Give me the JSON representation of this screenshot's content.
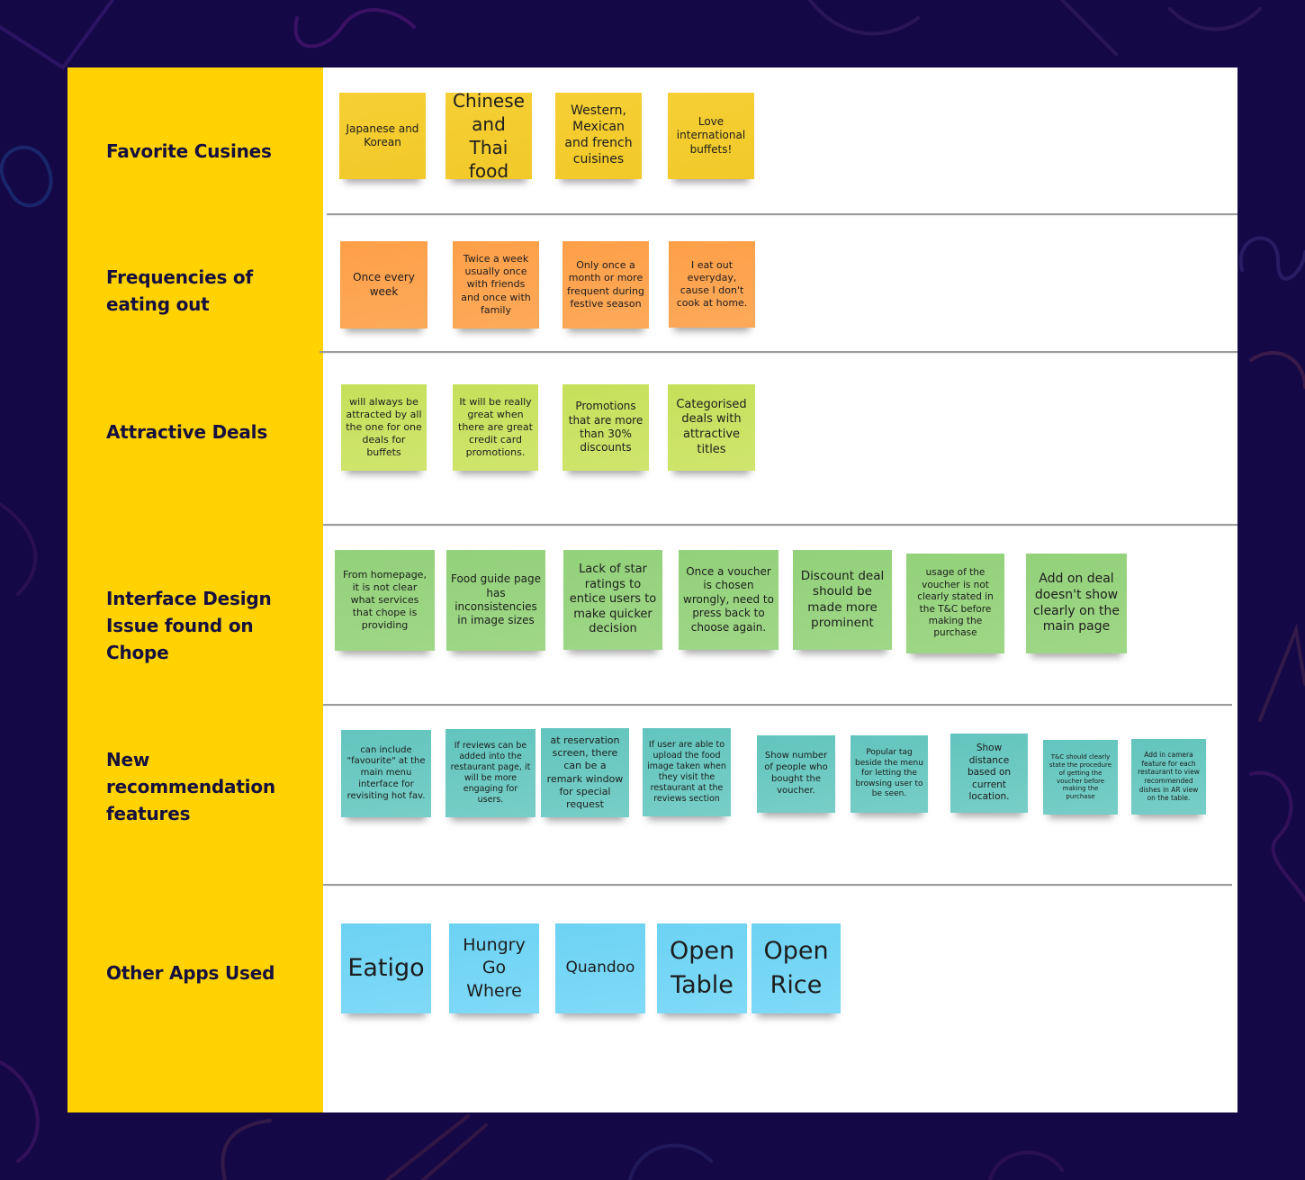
{
  "theme": {
    "background": "#150847",
    "label_column": "#ffd200",
    "label_text": "#15103f",
    "board": "#ffffff",
    "note_colors": {
      "yellow": "#f3cb2d",
      "orange": "#fea250",
      "lime": "#c9e262",
      "green": "#97d37f",
      "teal": "#69c8c0",
      "cyan": "#74d5f5"
    }
  },
  "rows": [
    {
      "label": "Favorite Cusines",
      "color": "yellow",
      "notes": [
        "Japanese and  Korean",
        "Chinese and Thai food",
        "Western, Mexican and french cuisines",
        "Love international buffets!"
      ]
    },
    {
      "label": "Frequencies of eating out",
      "color": "orange",
      "notes": [
        "Once every week",
        "Twice a week usually once with friends and once with family",
        "Only once a month or more frequent during festive season",
        "I eat out everyday, cause I don't cook at home."
      ]
    },
    {
      "label": "Attractive Deals",
      "color": "lime",
      "notes": [
        "will always be attracted by all the one for one deals for buffets",
        "It will be really great when there are great credit card promotions.",
        "Promotions that are more than 30% discounts",
        "Categorised deals with attractive titles"
      ]
    },
    {
      "label": "Interface Design Issue found on Chope",
      "color": "green",
      "notes": [
        "From homepage, it is not clear what services that chope is providing",
        "Food guide page has inconsistencies in image sizes",
        "Lack of star ratings to entice users to make quicker decision",
        "Once a voucher is chosen wrongly, need to press back to choose again.",
        "Discount deal should be made more prominent",
        "usage of the voucher is not clearly stated in the T&C before making the purchase",
        "Add on deal doesn't show clearly on the main page"
      ]
    },
    {
      "label": "New recommendation features",
      "color": "teal",
      "notes": [
        "can include \"favourite\" at the main menu interface for revisiting hot fav.",
        "If reviews can be added into the restaurant page, it will be more engaging for users.",
        "at reservation screen, there can be a remark window for special request",
        "If user are able to upload the food image taken when they visit the restaurant at the reviews section",
        "Show number of people who bought the voucher.",
        "Popular tag beside the menu for letting the browsing user to be seen.",
        "Show distance based on current location.",
        "T&C should clearly state the procedure of getting the voucher before making the purchase",
        "Add in camera feature for each restaurant to view recommended dishes in AR view on the table."
      ]
    },
    {
      "label": "Other Apps Used",
      "color": "cyan",
      "notes": [
        "Eatigo",
        "Hungry Go Where",
        "Quandoo",
        "Open Table",
        "Open Rice"
      ]
    }
  ]
}
